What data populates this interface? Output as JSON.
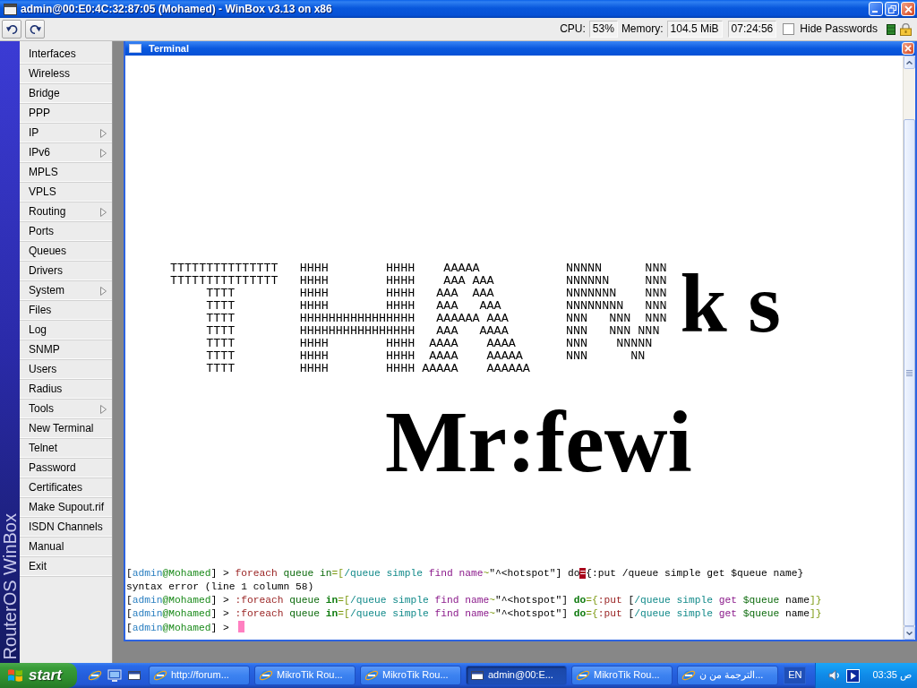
{
  "window": {
    "title": "admin@00:E0:4C:32:87:05 (Mohamed) - WinBox v3.13 on x86"
  },
  "toolbar": {
    "cpu_label": "CPU:",
    "cpu": "53%",
    "memory_label": "Memory:",
    "memory": "104.5 MiB",
    "time": "07:24:56",
    "hide_passwords": {
      "label": "Hide Passwords",
      "checked": false
    }
  },
  "sidebar": {
    "brand": "RouterOS WinBox",
    "items": [
      {
        "label": "Interfaces",
        "submenu": false
      },
      {
        "label": "Wireless",
        "submenu": false
      },
      {
        "label": "Bridge",
        "submenu": false
      },
      {
        "label": "PPP",
        "submenu": false
      },
      {
        "label": "IP",
        "submenu": true
      },
      {
        "label": "IPv6",
        "submenu": true
      },
      {
        "label": "MPLS",
        "submenu": false
      },
      {
        "label": "VPLS",
        "submenu": false
      },
      {
        "label": "Routing",
        "submenu": true
      },
      {
        "label": "Ports",
        "submenu": false
      },
      {
        "label": "Queues",
        "submenu": false
      },
      {
        "label": "Drivers",
        "submenu": false
      },
      {
        "label": "System",
        "submenu": true
      },
      {
        "label": "Files",
        "submenu": false
      },
      {
        "label": "Log",
        "submenu": false
      },
      {
        "label": "SNMP",
        "submenu": false
      },
      {
        "label": "Users",
        "submenu": false
      },
      {
        "label": "Radius",
        "submenu": false
      },
      {
        "label": "Tools",
        "submenu": true
      },
      {
        "label": "New Terminal",
        "submenu": false
      },
      {
        "label": "Telnet",
        "submenu": false
      },
      {
        "label": "Password",
        "submenu": false
      },
      {
        "label": "Certificates",
        "submenu": false
      },
      {
        "label": "Make Supout.rif",
        "submenu": false
      },
      {
        "label": "ISDN Channels",
        "submenu": false
      },
      {
        "label": "Manual",
        "submenu": false
      },
      {
        "label": "Exit",
        "submenu": false
      }
    ]
  },
  "terminal": {
    "title": "Terminal",
    "art_lines": [
      "TTTTTTTTTTTTTTT   HHHH        HHHH    AAAAA            NNNNN      NNN",
      "TTTTTTTTTTTTTTT   HHHH        HHHH    AAA AAA          NNNNNN     NNN",
      "     TTTT         HHHH        HHHH   AAA  AAA          NNNNNNN    NNN",
      "     TTTT         HHHH        HHHH   AAA   AAA         NNNNNNNN   NNN",
      "     TTTT         HHHHHHHHHHHHHHHH   AAAAAA AAA        NNN   NNN  NNN",
      "     TTTT         HHHHHHHHHHHHHHHH   AAA   AAAA        NNN   NNN NNN",
      "     TTTT         HHHH        HHHH  AAAA    AAAA       NNN    NNNNN",
      "     TTTT         HHHH        HHHH  AAAA    AAAAA      NNN      NN",
      "     TTTT         HHHH        HHHH AAAAA    AAAAAA"
    ],
    "art_letters": "k s",
    "banner": "Mr:fewi",
    "lines": [
      {
        "cursor": false,
        "segments": [
          {
            "text": "[",
            "kind": "plain"
          },
          {
            "text": "admin",
            "kind": "user"
          },
          {
            "text": "@Mohamed",
            "kind": "host"
          },
          {
            "text": "] > ",
            "kind": "plain"
          },
          {
            "text": "foreach",
            "kind": "command"
          },
          {
            "text": " queue ",
            "kind": "variable"
          },
          {
            "text": "in",
            "kind": "variable"
          },
          {
            "text": "=[",
            "kind": "operator"
          },
          {
            "text": "/queue simple",
            "kind": "path"
          },
          {
            "text": " find name",
            "kind": "action"
          },
          {
            "text": "~",
            "kind": "operator"
          },
          {
            "text": "\"^<hotspot\"] do",
            "kind": "plain"
          },
          {
            "text": "=",
            "kind": "error"
          },
          {
            "text": "{:put /queue simple get $queue name}",
            "kind": "plain"
          }
        ]
      },
      {
        "cursor": false,
        "segments": [
          {
            "text": "syntax error (line 1 column 58)",
            "kind": "plain"
          }
        ]
      },
      {
        "cursor": false,
        "segments": [
          {
            "text": "[",
            "kind": "plain"
          },
          {
            "text": "admin",
            "kind": "user"
          },
          {
            "text": "@Mohamed",
            "kind": "host"
          },
          {
            "text": "] > ",
            "kind": "plain"
          },
          {
            "text": ":foreach",
            "kind": "command"
          },
          {
            "text": " queue ",
            "kind": "variable"
          },
          {
            "text": "in",
            "kind": "keyword"
          },
          {
            "text": "=[",
            "kind": "operator"
          },
          {
            "text": "/queue simple",
            "kind": "path"
          },
          {
            "text": " find name",
            "kind": "action"
          },
          {
            "text": "~",
            "kind": "operator"
          },
          {
            "text": "\"^<hotspot\"] ",
            "kind": "plain"
          },
          {
            "text": "do",
            "kind": "keyword"
          },
          {
            "text": "={",
            "kind": "operator"
          },
          {
            "text": ":put",
            "kind": "command"
          },
          {
            "text": " [",
            "kind": "plain"
          },
          {
            "text": "/queue simple",
            "kind": "path"
          },
          {
            "text": " get",
            "kind": "action"
          },
          {
            "text": " $queue",
            "kind": "variable"
          },
          {
            "text": " name",
            "kind": "plain"
          },
          {
            "text": "]}",
            "kind": "operator"
          }
        ]
      },
      {
        "cursor": false,
        "segments": [
          {
            "text": "[",
            "kind": "plain"
          },
          {
            "text": "admin",
            "kind": "user"
          },
          {
            "text": "@Mohamed",
            "kind": "host"
          },
          {
            "text": "] > ",
            "kind": "plain"
          },
          {
            "text": ":foreach",
            "kind": "command"
          },
          {
            "text": " queue ",
            "kind": "variable"
          },
          {
            "text": "in",
            "kind": "keyword"
          },
          {
            "text": "=[",
            "kind": "operator"
          },
          {
            "text": "/queue simple",
            "kind": "path"
          },
          {
            "text": " find name",
            "kind": "action"
          },
          {
            "text": "~",
            "kind": "operator"
          },
          {
            "text": "\"^<hotspot\"] ",
            "kind": "plain"
          },
          {
            "text": "do",
            "kind": "keyword"
          },
          {
            "text": "={",
            "kind": "operator"
          },
          {
            "text": ":put",
            "kind": "command"
          },
          {
            "text": " [",
            "kind": "plain"
          },
          {
            "text": "/queue simple",
            "kind": "path"
          },
          {
            "text": " get",
            "kind": "action"
          },
          {
            "text": " $queue",
            "kind": "variable"
          },
          {
            "text": " name",
            "kind": "plain"
          },
          {
            "text": "]}",
            "kind": "operator"
          }
        ]
      },
      {
        "cursor": true,
        "segments": [
          {
            "text": "[",
            "kind": "plain"
          },
          {
            "text": "admin",
            "kind": "user"
          },
          {
            "text": "@Mohamed",
            "kind": "host"
          },
          {
            "text": "] > ",
            "kind": "plain"
          }
        ]
      }
    ]
  },
  "taskbar": {
    "start": "start",
    "tasks": [
      {
        "label": "http://forum...",
        "kind": "browser",
        "selected": false
      },
      {
        "label": "MikroTik Rou...",
        "kind": "browser",
        "selected": false
      },
      {
        "label": "MikroTik Rou...",
        "kind": "browser",
        "selected": false
      },
      {
        "label": "admin@00:E...",
        "kind": "winbox",
        "selected": true
      },
      {
        "label": "MikroTik Rou...",
        "kind": "browser",
        "selected": false
      },
      {
        "label": "الترجمة من ن...",
        "kind": "browser",
        "selected": false
      }
    ],
    "language": "EN",
    "clock": "03:35 ص"
  }
}
